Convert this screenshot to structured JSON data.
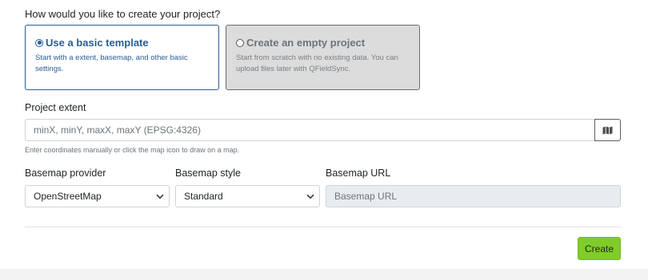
{
  "question": "How would you like to create your project?",
  "options": [
    {
      "title": "Use a basic template",
      "description": "Start with a extent, basemap, and other basic settings.",
      "selected": true
    },
    {
      "title": "Create an empty project",
      "description": "Start from scratch with no existing data. You can upload files later with QFieldSync.",
      "selected": false
    }
  ],
  "extent": {
    "label": "Project extent",
    "placeholder": "minX, minY, maxX, maxY (EPSG:4326)",
    "hint": "Enter coordinates manually or click the map icon to draw on a map.",
    "map_icon": "map-icon"
  },
  "basemap": {
    "provider_label": "Basemap provider",
    "provider_value": "OpenStreetMap",
    "style_label": "Basemap style",
    "style_value": "Standard",
    "url_label": "Basemap URL",
    "url_placeholder": "Basemap URL"
  },
  "actions": {
    "create_label": "Create"
  },
  "colors": {
    "accent": "#2a5d96",
    "create_button": "#80cc28"
  }
}
